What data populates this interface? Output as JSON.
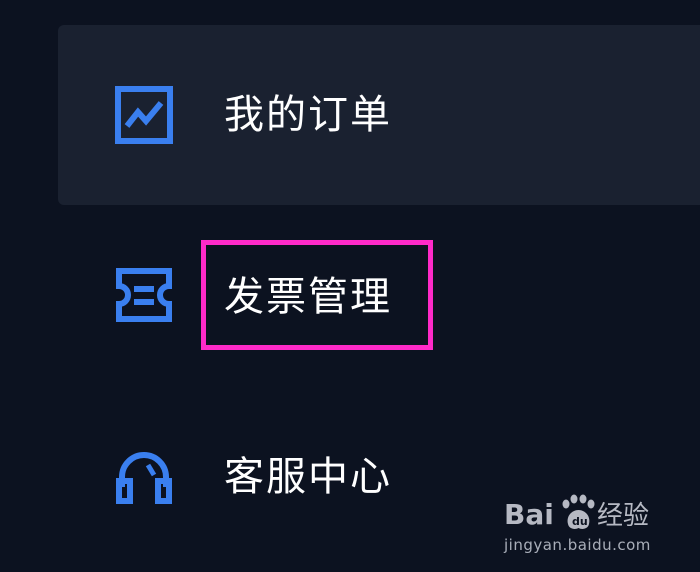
{
  "menu": {
    "items": [
      {
        "label": "我的订单",
        "icon": "chart-icon",
        "active": true
      },
      {
        "label": "发票管理",
        "icon": "ticket-icon",
        "active": false,
        "highlighted": true
      },
      {
        "label": "客服中心",
        "icon": "headset-icon",
        "active": false
      }
    ]
  },
  "watermark": {
    "logo_text": "Bai du 经验",
    "url": "jingyan.baidu.com"
  },
  "colors": {
    "background": "#0c1220",
    "active_item_bg": "#1a2130",
    "icon_blue": "#3a7fef",
    "highlight": "#ff2ac8",
    "text": "#ffffff"
  }
}
